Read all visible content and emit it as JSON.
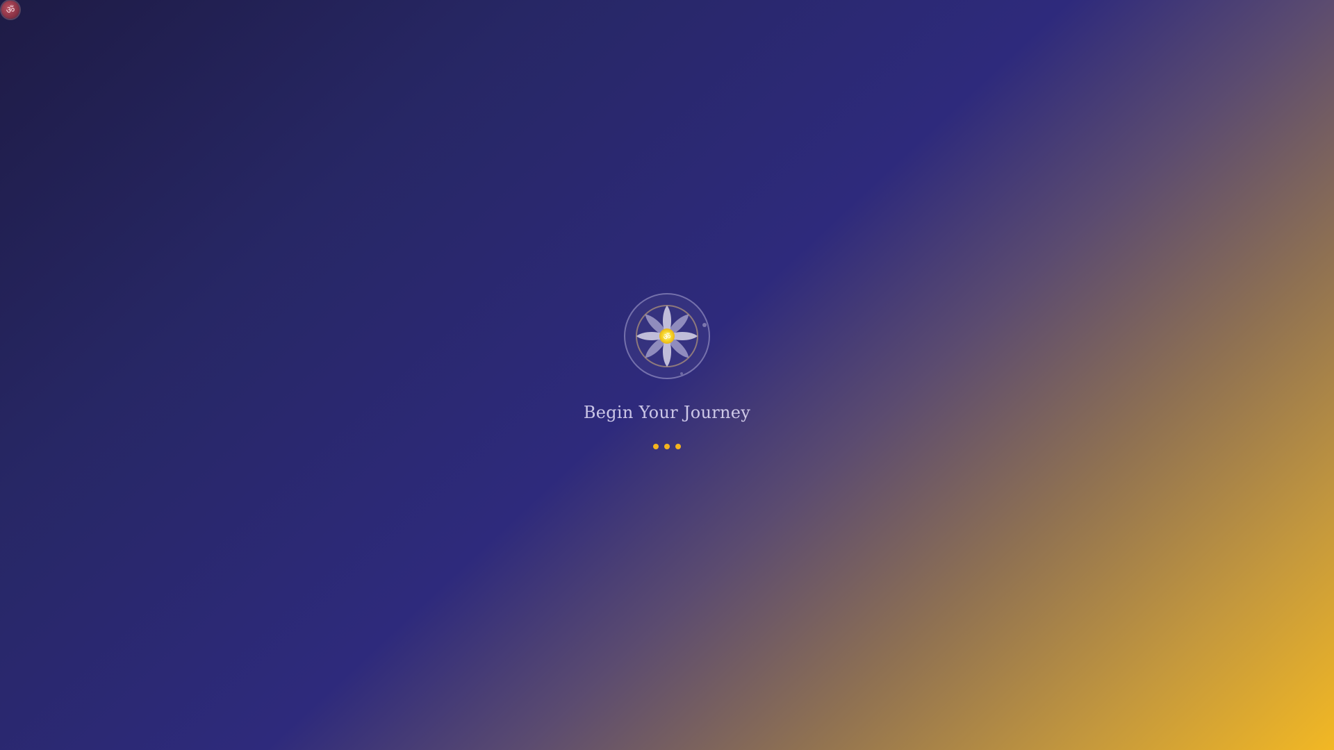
{
  "splash": {
    "title": "Begin Your Journey",
    "symbol": "ॐ",
    "loading_dots": 3
  },
  "corner_badge": {
    "icon": "om-icon",
    "symbol": "ॐ"
  },
  "colors": {
    "background_start": "#1e1b45",
    "background_mid": "#2e2a7c",
    "background_end": "#f2b824",
    "accent": "#f4b41e",
    "lotus_petal": "#e8e4f2",
    "title_text": "#e6e2fa"
  }
}
